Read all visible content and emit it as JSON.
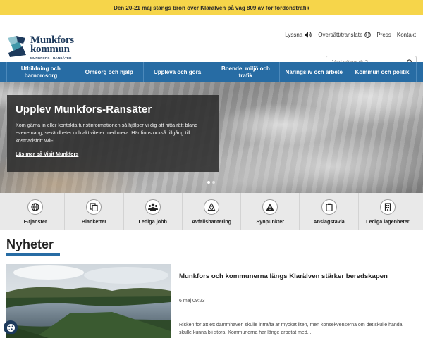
{
  "alert": {
    "text": "Den 20-21 maj stängs bron över Klarälven på väg 809 av för fordonstrafik"
  },
  "logo": {
    "name_line1": "Munkfors",
    "name_line2": "kommun",
    "subtitle": "MUNKFORS | RANSÄTER",
    "colors": {
      "mark_dark": "#1d3a5c",
      "mark_teal": "#3f97a8",
      "mark_light": "#8fc4cf"
    }
  },
  "toplinks": [
    {
      "label": "Lyssna",
      "icon": "speaker-icon"
    },
    {
      "label": "Översätt/translate",
      "icon": "globe-icon"
    },
    {
      "label": "Press"
    },
    {
      "label": "Kontakt"
    }
  ],
  "search": {
    "placeholder": "Vad söker du?",
    "icon": "search-icon"
  },
  "nav": [
    {
      "label": "Utbildning och barnomsorg"
    },
    {
      "label": "Omsorg och hjälp"
    },
    {
      "label": "Uppleva och göra"
    },
    {
      "label": "Boende, miljö och trafik"
    },
    {
      "label": "Näringsliv och arbete"
    },
    {
      "label": "Kommun och politik"
    }
  ],
  "hero": {
    "title": "Upplev Munkfors-Ransäter",
    "text": "Kom gärna in eller kontakta turistinformationen så hjälper vi dig att hitta rätt bland evenemang, sevärdheter och aktiviteter med mera. Här finns också tillgång till kostnadsfritt WiFi.",
    "link": "Läs mer på Visit Munkfors",
    "slides_total": 2,
    "slide_active": 1
  },
  "quicklinks": [
    {
      "label": "E-tjänster",
      "icon": "globe-icon"
    },
    {
      "label": "Blanketter",
      "icon": "documents-icon"
    },
    {
      "label": "Lediga jobb",
      "icon": "people-icon"
    },
    {
      "label": "Avfallshantering",
      "icon": "recycle-icon"
    },
    {
      "label": "Synpunkter",
      "icon": "warning-icon"
    },
    {
      "label": "Anslagstavla",
      "icon": "clipboard-icon"
    },
    {
      "label": "Lediga lägenheter",
      "icon": "building-icon"
    }
  ],
  "news": {
    "heading": "Nyheter",
    "items": [
      {
        "title": "Munkfors och kommunerna längs Klarälven stärker beredskapen",
        "date": "6 maj 09:23",
        "text": "Risken för att ett dammhaveri skulle inträffa är mycket liten, men konsekvenserna om det skulle hända skulle kunna bli stora. Kommunerna har länge arbetat med...",
        "image_icon": "river-photo"
      }
    ]
  },
  "cookie": {
    "icon": "cookie-icon"
  },
  "colors": {
    "alert_bg": "#f6d54a",
    "nav_bg": "#276ca4",
    "brand_dark": "#1d3a5c"
  }
}
